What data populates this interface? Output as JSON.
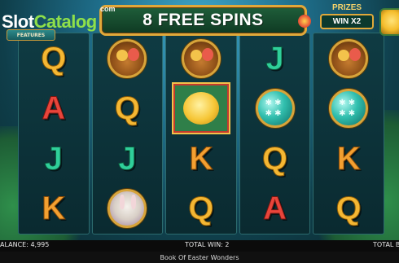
{
  "logo": {
    "com": "com",
    "slot": "Slot",
    "catalog": "Catalog"
  },
  "features_tab": {
    "label": "FEATURES"
  },
  "banner": {
    "text": "8  FREE SPINS"
  },
  "prizes": {
    "title": "PRIZES",
    "multiplier": "WIN X2"
  },
  "reels": [
    [
      "basket",
      "Q",
      "A",
      "J",
      "K"
    ],
    [
      "basket",
      "Q",
      "J",
      "bunny"
    ],
    [
      "basket",
      "chick",
      "K",
      "Q"
    ],
    [
      "J",
      "egg",
      "Q",
      "A"
    ],
    [
      "basket",
      "egg",
      "K",
      "Q"
    ]
  ],
  "grid": [
    [
      "Q",
      "basket",
      "basket",
      "J",
      "basket"
    ],
    [
      "A",
      "Q",
      "chick",
      "egg",
      "egg"
    ],
    [
      "J",
      "J",
      "K",
      "Q",
      "K"
    ],
    [
      "K",
      "bunny",
      "Q",
      "A",
      "Q"
    ]
  ],
  "status": {
    "balance": "ALANCE: 4,995",
    "total_win": "TOTAL WIN: 2",
    "total_bet": "TOTAL B"
  },
  "footer": {
    "game_title": "Book Of Easter Wonders"
  }
}
